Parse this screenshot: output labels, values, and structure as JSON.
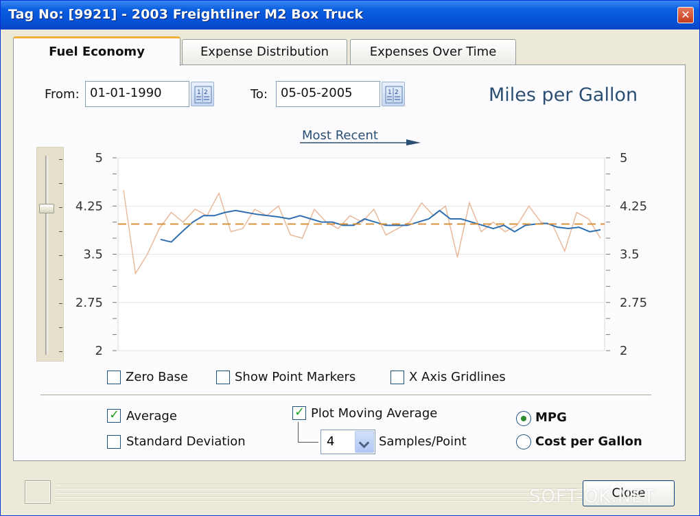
{
  "window": {
    "title": "Tag No: [9921] - 2003 Freightliner M2 Box Truck",
    "close_glyph": "✕"
  },
  "tabs": [
    {
      "label": "Fuel Economy",
      "active": true
    },
    {
      "label": "Expense Distribution",
      "active": false
    },
    {
      "label": "Expenses Over Time",
      "active": false
    }
  ],
  "date_range": {
    "from_label": "From:",
    "from_value": "01-01-1990",
    "to_label": "To:",
    "to_value": "05-05-2005",
    "calendar_icon": "calendar-icon"
  },
  "chart_header": {
    "metric_title": "Miles per Gallon",
    "direction_label": "Most Recent"
  },
  "chart_data": {
    "type": "line",
    "ylim": [
      2,
      5
    ],
    "y_ticks": [
      "5",
      "4.25",
      "3.5",
      "2.75",
      "2"
    ],
    "grid": true,
    "average_value": 3.97,
    "series": [
      {
        "values": [
          4.5,
          3.2,
          3.5,
          3.9,
          4.15,
          4.0,
          4.2,
          4.1,
          4.45,
          3.85,
          3.9,
          4.2,
          4.1,
          4.25,
          3.8,
          3.75,
          4.2,
          4.0,
          3.9,
          4.1,
          4.0,
          4.2,
          3.8,
          3.9,
          4.0,
          4.3,
          4.1,
          4.25,
          3.45,
          4.3,
          3.85,
          4.0,
          3.85,
          3.95,
          4.25,
          4.0,
          3.95,
          3.55,
          4.15,
          4.05,
          3.75
        ],
        "color": "#e9b99c"
      },
      {
        "values": [
          3.73,
          3.69,
          3.85,
          4.0,
          4.1,
          4.1,
          4.15,
          4.18,
          4.15,
          4.12,
          4.1,
          4.08,
          4.05,
          4.1,
          4.05,
          4.0,
          4.0,
          3.95,
          3.95,
          4.05,
          4.0,
          3.95,
          3.95,
          3.95,
          4.0,
          4.05,
          4.18,
          4.05,
          4.05,
          4.0,
          3.95,
          3.9,
          3.95,
          3.85,
          3.95,
          3.97,
          3.98,
          3.92,
          3.9,
          3.92,
          3.85,
          3.88
        ],
        "color": "#2e6fb0"
      }
    ],
    "average_color": "#d9923c"
  },
  "chart_options": {
    "zero_base": {
      "label": "Zero Base",
      "checked": false
    },
    "show_point_markers": {
      "label": "Show Point Markers",
      "checked": false
    },
    "x_axis_gridlines": {
      "label": "X Axis Gridlines",
      "checked": false
    }
  },
  "stats_options": {
    "average": {
      "label": "Average",
      "checked": true
    },
    "standard_deviation": {
      "label": "Standard Deviation",
      "checked": false
    },
    "plot_moving_average": {
      "label": "Plot Moving Average",
      "checked": true
    },
    "samples_value": "4",
    "samples_label": "Samples/Point"
  },
  "units": {
    "mpg": {
      "label": "MPG",
      "selected": true
    },
    "cost_per_gallon": {
      "label": "Cost per Gallon",
      "selected": false
    }
  },
  "footer": {
    "close_label": "Close",
    "watermark": "SOFT-OK.NET"
  }
}
